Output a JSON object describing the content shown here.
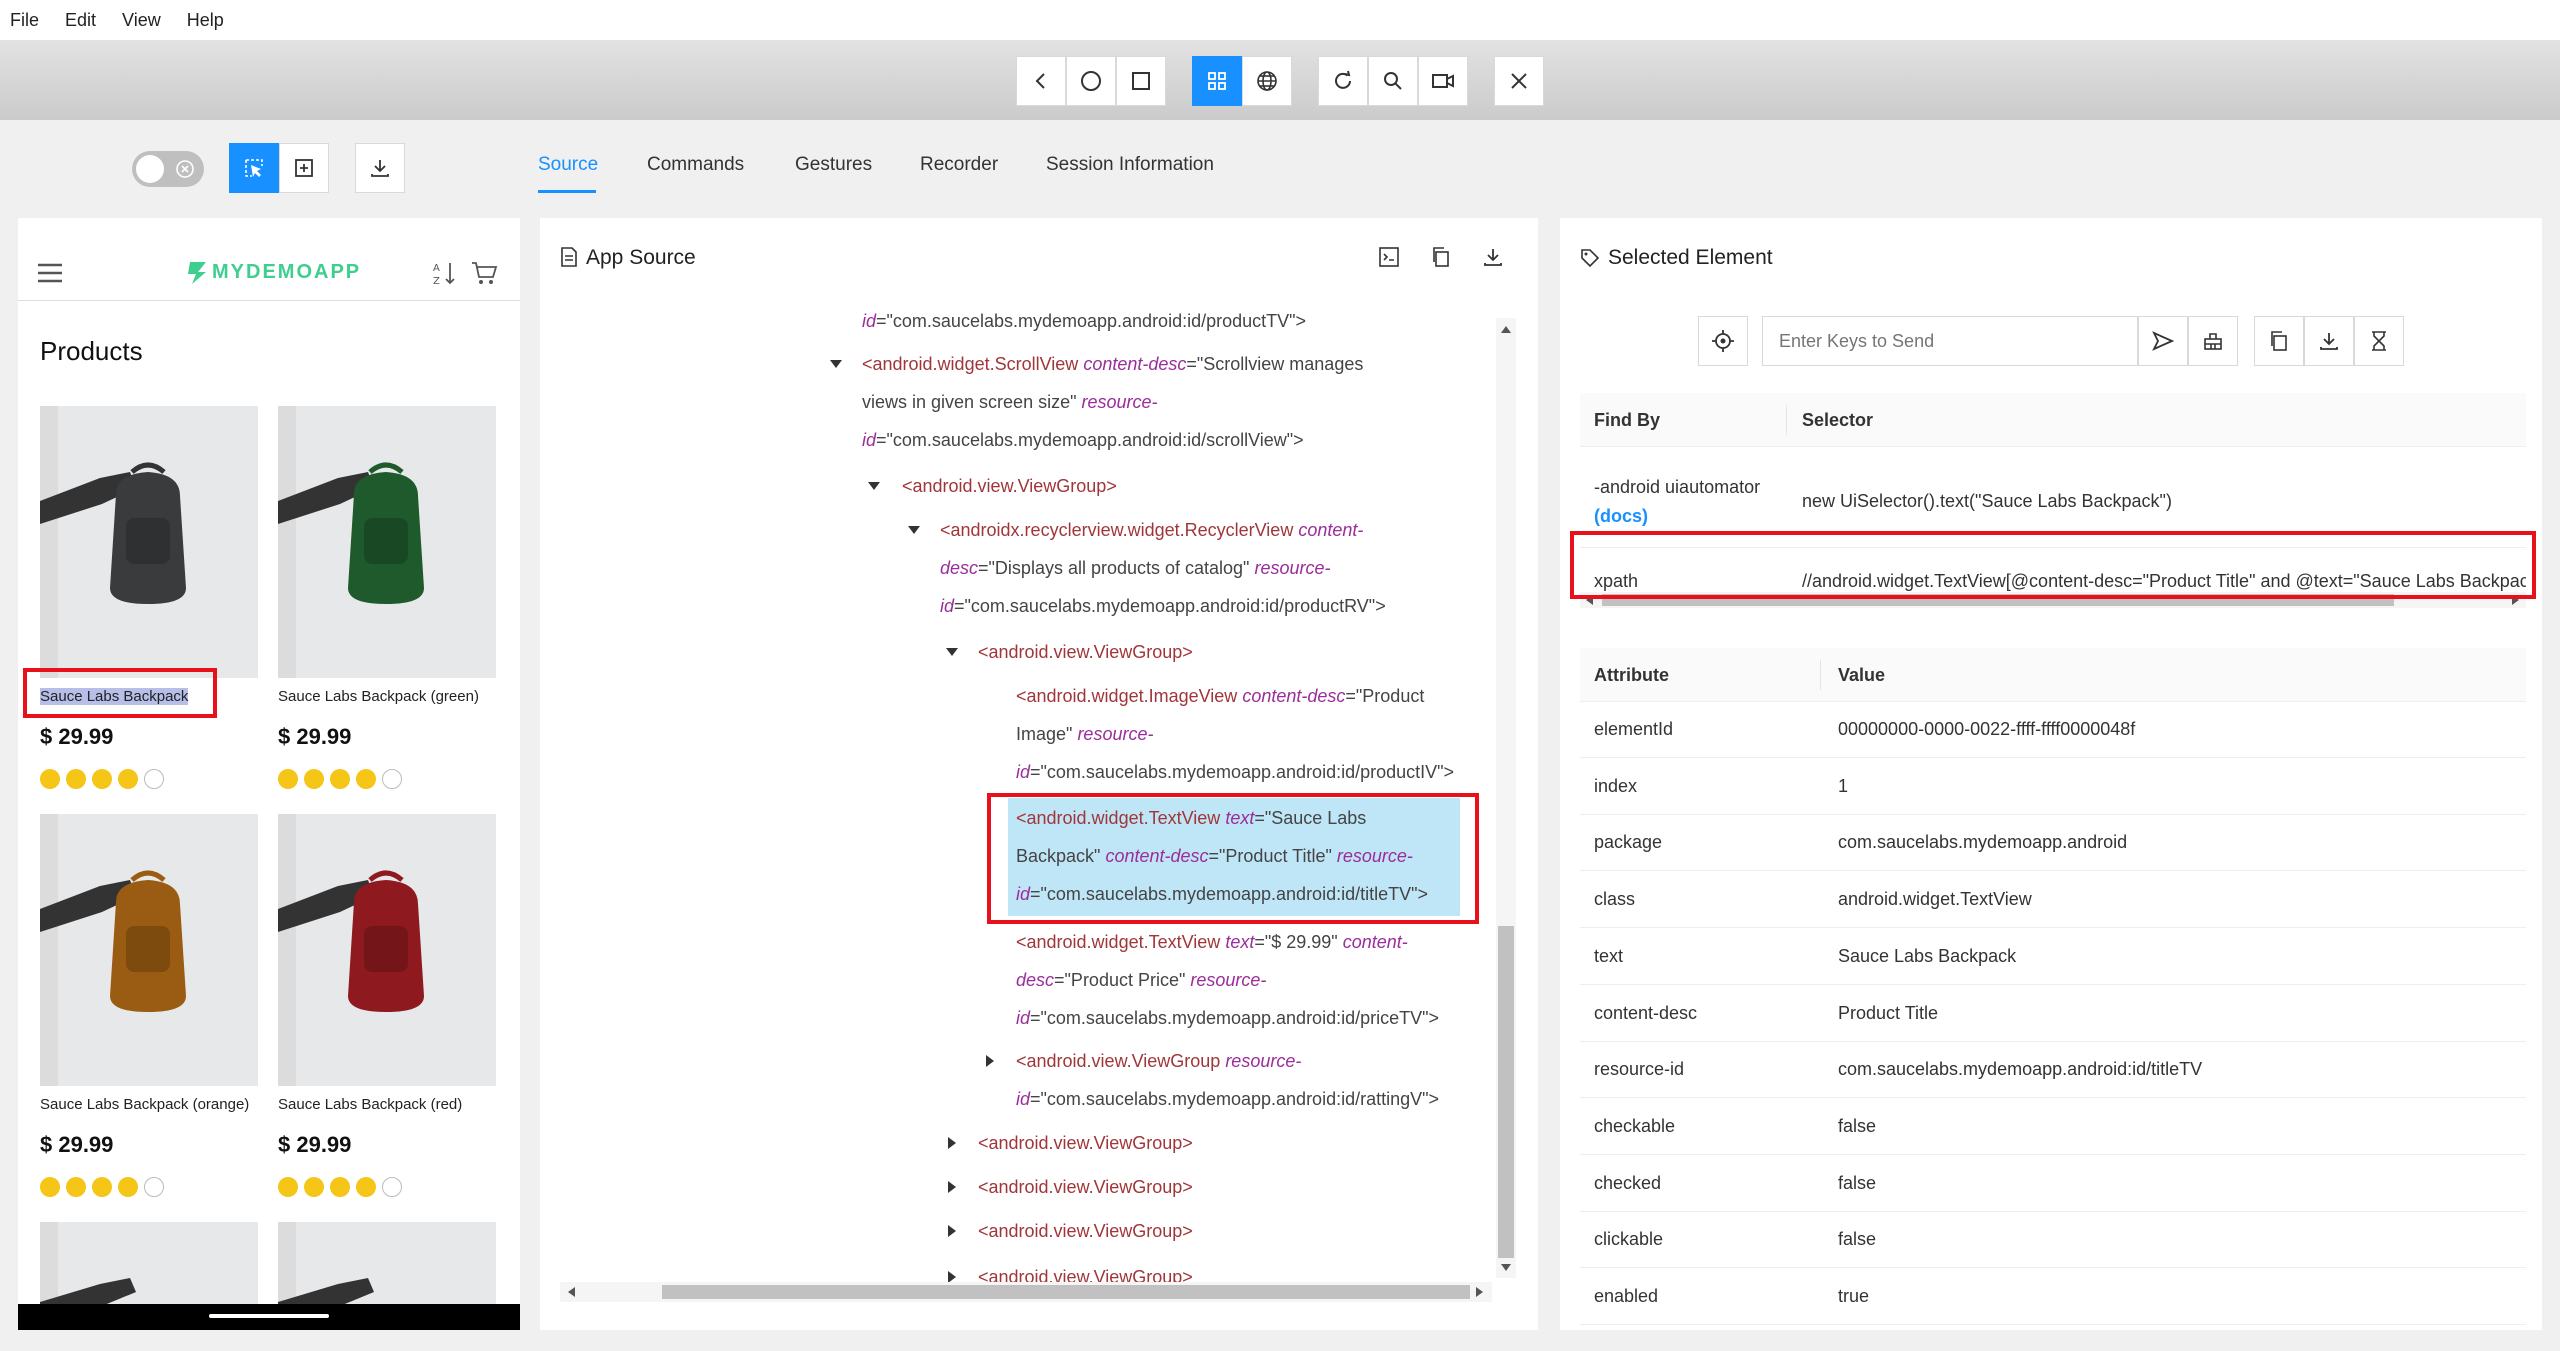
{
  "menubar": {
    "items": [
      "File",
      "Edit",
      "View",
      "Help"
    ]
  },
  "app_toolbar": {
    "buttons": [
      "back-icon",
      "home-icon",
      "app-switch-icon",
      "native-mode-icon",
      "web-mode-icon",
      "refresh-icon",
      "search-icon",
      "record-icon",
      "quit-icon"
    ]
  },
  "tabs": [
    {
      "label": "Source",
      "active": true
    },
    {
      "label": "Commands"
    },
    {
      "label": "Gestures"
    },
    {
      "label": "Recorder"
    },
    {
      "label": "Session Information"
    }
  ],
  "device": {
    "app_name": "MYDEMOAPP",
    "page_title": "Products",
    "products": [
      {
        "name": "Sauce Labs Backpack",
        "price": "$ 29.99",
        "rating": 4,
        "color": "#3a3b3d",
        "selected": true
      },
      {
        "name": "Sauce Labs Backpack (green)",
        "price": "$ 29.99",
        "rating": 4,
        "color": "#1f5a2c"
      },
      {
        "name": "Sauce Labs Backpack (orange)",
        "price": "$ 29.99",
        "rating": 4,
        "color": "#9a5c12"
      },
      {
        "name": "Sauce Labs Backpack (red)",
        "price": "$ 29.99",
        "rating": 4,
        "color": "#8e1a1f"
      }
    ]
  },
  "source_panel": {
    "title": "App Source",
    "nodes": {
      "n0": {
        "a1": "id",
        "v1": "=\"com.saucelabs.mydemoapp.android:id/productTV\">"
      },
      "n1": {
        "tag": "<android.widget.ScrollView",
        "a1": "content-desc",
        "v1": "=\"Scrollview manages",
        "v1b": "views in given screen size\"",
        "a2": "resource-",
        "a2b": "id",
        "v2": "=\"com.saucelabs.mydemoapp.android:id/scrollView\">"
      },
      "n2": {
        "tag": "<android.view.ViewGroup>"
      },
      "n3": {
        "tag": "<androidx.recyclerview.widget.RecyclerView",
        "a1": "content-",
        "a1b": "desc",
        "v1": "=\"Displays all products of catalog\"",
        "a2": "resource-",
        "a2b": "id",
        "v2": "=\"com.saucelabs.mydemoapp.android:id/productRV\">"
      },
      "n4": {
        "tag": "<android.view.ViewGroup>"
      },
      "n5": {
        "tag": "<android.widget.ImageView",
        "a1": "content-desc",
        "v1": "=\"Product",
        "v1b": "Image\"",
        "a2": "resource-",
        "a2b": "id",
        "v2": "=\"com.saucelabs.mydemoapp.android:id/productIV\">"
      },
      "n6": {
        "tag": "<android.widget.TextView",
        "a1": "text",
        "v1": "=\"Sauce Labs",
        "v1b": "Backpack\"",
        "a2": "content-desc",
        "v2": "=\"Product Title\"",
        "a3": "resource-",
        "a3b": "id",
        "v3": "=\"com.saucelabs.mydemoapp.android:id/titleTV\">"
      },
      "n7": {
        "tag": "<android.widget.TextView",
        "a1": "text",
        "v1": "=\"$ 29.99\"",
        "a2": "content-",
        "a2b": "desc",
        "v2": "=\"Product Price\"",
        "a3": "resource-",
        "a3b": "id",
        "v3": "=\"com.saucelabs.mydemoapp.android:id/priceTV\">"
      },
      "n8": {
        "tag": "<android.view.ViewGroup",
        "a1": "resource-",
        "a1b": "id",
        "v1": "=\"com.saucelabs.mydemoapp.android:id/rattingV\">"
      },
      "n9": {
        "tag": "<android.view.ViewGroup>"
      },
      "n10": {
        "tag": "<android.view.ViewGroup>"
      },
      "n11": {
        "tag": "<android.view.ViewGroup>"
      },
      "n12": {
        "tag": "<android.view.ViewGroup>"
      }
    }
  },
  "selected_panel": {
    "title": "Selected Element",
    "send_keys_placeholder": "Enter Keys to Send",
    "find_by_header": {
      "col1": "Find By",
      "col2": "Selector"
    },
    "find_by_rows": [
      {
        "strategy": "-android uiautomator",
        "docs": "(docs)",
        "selector": "new UiSelector().text(\"Sauce Labs Backpack\")"
      },
      {
        "strategy": "xpath",
        "selector": "//android.widget.TextView[@content-desc=\"Product Title\" and @text=\"Sauce Labs Backpack\"]"
      }
    ],
    "attr_header": {
      "col1": "Attribute",
      "col2": "Value"
    },
    "attributes": [
      {
        "name": "elementId",
        "value": "00000000-0000-0022-ffff-ffff0000048f"
      },
      {
        "name": "index",
        "value": "1"
      },
      {
        "name": "package",
        "value": "com.saucelabs.mydemoapp.android"
      },
      {
        "name": "class",
        "value": "android.widget.TextView"
      },
      {
        "name": "text",
        "value": "Sauce Labs Backpack"
      },
      {
        "name": "content-desc",
        "value": "Product Title"
      },
      {
        "name": "resource-id",
        "value": "com.saucelabs.mydemoapp.android:id/titleTV"
      },
      {
        "name": "checkable",
        "value": "false"
      },
      {
        "name": "checked",
        "value": "false"
      },
      {
        "name": "clickable",
        "value": "false"
      },
      {
        "name": "enabled",
        "value": "true"
      }
    ]
  },
  "colors": {
    "accent": "#1890ff",
    "highlight": "#bfe6f7",
    "annotation": "#e8101a",
    "star": "#f5c518",
    "brand": "#3ecf8e"
  }
}
